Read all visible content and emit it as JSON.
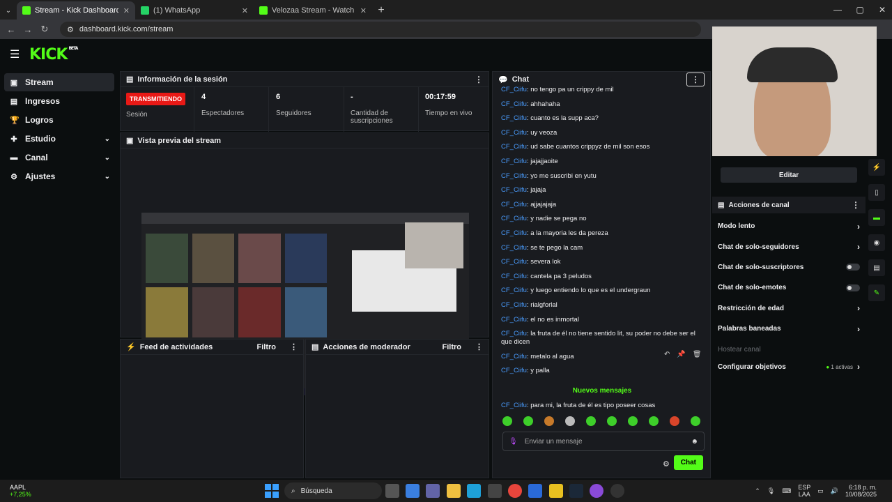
{
  "browser": {
    "tabs": [
      {
        "title": "Stream - Kick Dashboard",
        "color": "#53fc18",
        "active": true
      },
      {
        "title": "(1) WhatsApp",
        "color": "#25d366",
        "active": false
      },
      {
        "title": "Velozaa Stream - Watch Live on",
        "color": "#53fc18",
        "active": false
      }
    ],
    "url": "dashboard.kick.com/stream"
  },
  "brand": {
    "logo": "KICK",
    "beta": "BETA"
  },
  "sidebar": {
    "items": [
      {
        "label": "Stream",
        "icon": "stream-icon",
        "glyph": "▣",
        "active": true,
        "chevron": false
      },
      {
        "label": "Ingresos",
        "icon": "revenue-icon",
        "glyph": "▤",
        "active": false,
        "chevron": false
      },
      {
        "label": "Logros",
        "icon": "trophy-icon",
        "glyph": "🏆",
        "active": false,
        "chevron": false
      },
      {
        "label": "Estudio",
        "icon": "studio-icon",
        "glyph": "✚",
        "active": false,
        "chevron": true
      },
      {
        "label": "Canal",
        "icon": "channel-icon",
        "glyph": "▬",
        "active": false,
        "chevron": true
      },
      {
        "label": "Ajustes",
        "icon": "settings-icon",
        "glyph": "⚙",
        "active": false,
        "chevron": true
      }
    ]
  },
  "session": {
    "title": "Información de la sesión",
    "badge": "TRANSMITIENDO",
    "badge_label": "Sesión",
    "stats": [
      {
        "value": "4",
        "label": "Espectadores"
      },
      {
        "value": "6",
        "label": "Seguidores"
      },
      {
        "value": "-",
        "label": "Cantidad de suscripciones"
      },
      {
        "value": "00:17:59",
        "label": "Tiempo en vivo"
      }
    ]
  },
  "preview": {
    "title": "Vista previa del stream"
  },
  "activity": {
    "title": "Feed de actividades",
    "filter": "Filtro"
  },
  "moderator": {
    "title": "Acciones de moderador",
    "filter": "Filtro"
  },
  "chat": {
    "title": "Chat",
    "messages": [
      {
        "user": "CF_Ciifu",
        "text": "no tengo pa un crippy de mil"
      },
      {
        "user": "CF_Ciifu",
        "text": "ahhahaha"
      },
      {
        "user": "CF_Ciifu",
        "text": "cuanto es la supp aca?"
      },
      {
        "user": "CF_Ciifu",
        "text": "uy veoza"
      },
      {
        "user": "CF_Ciifu",
        "text": "ud sabe cuantos crippyz de mil son esos"
      },
      {
        "user": "CF_Ciifu",
        "text": "jajajjaoite"
      },
      {
        "user": "CF_Ciifu",
        "text": "yo me suscribi en yutu"
      },
      {
        "user": "CF_Ciifu",
        "text": "jajaja"
      },
      {
        "user": "CF_Ciifu",
        "text": "ajjajajaja"
      },
      {
        "user": "CF_Ciifu",
        "text": "y nadie se pega no"
      },
      {
        "user": "CF_Ciifu",
        "text": "a la mayoria les da pereza"
      },
      {
        "user": "CF_Ciifu",
        "text": "se te pego la cam"
      },
      {
        "user": "CF_Ciifu",
        "text": "severa lok"
      },
      {
        "user": "CF_Ciifu",
        "text": "cantela pa 3 peludos"
      },
      {
        "user": "CF_Ciifu",
        "text": "y luego entiendo lo que es el undergraun"
      },
      {
        "user": "CF_Ciifu",
        "text": "rialgforlal"
      },
      {
        "user": "CF_Ciifu",
        "text": "el no es inmortal"
      },
      {
        "user": "CF_Ciifu",
        "text": "la fruta de él no tiene sentido lit, su poder no debe ser el que dicen"
      },
      {
        "user": "CF_Ciifu",
        "text": "metalo al agua"
      },
      {
        "user": "CF_Ciifu",
        "text": "y palla"
      }
    ],
    "new_messages": "Nuevos mensajes",
    "after": {
      "user": "CF_Ciifu",
      "text": "para mi, la fruta de él es tipo poseer cosas"
    },
    "input_placeholder": "Enviar un mensaje",
    "send": "Chat"
  },
  "actions": {
    "edit": "Editar",
    "title": "Acciones de canal",
    "items": [
      {
        "label": "Modo lento",
        "control": "chevron"
      },
      {
        "label": "Chat de solo-seguidores",
        "control": "chevron"
      },
      {
        "label": "Chat de solo-suscriptores",
        "control": "toggle"
      },
      {
        "label": "Chat de solo-emotes",
        "control": "toggle"
      },
      {
        "label": "Restricción de edad",
        "control": "chevron"
      },
      {
        "label": "Palabras baneadas",
        "control": "chevron"
      }
    ],
    "host": "Hostear canal",
    "goals": "Configurar objetivos",
    "goals_status": "1 activas"
  },
  "taskbar": {
    "ticker": "AAPL",
    "ticker_change": "+7,25%",
    "search": "Búsqueda",
    "lang": "ESP",
    "lang2": "LAA",
    "time": "6:18 p. m.",
    "date": "10/08/2025"
  }
}
